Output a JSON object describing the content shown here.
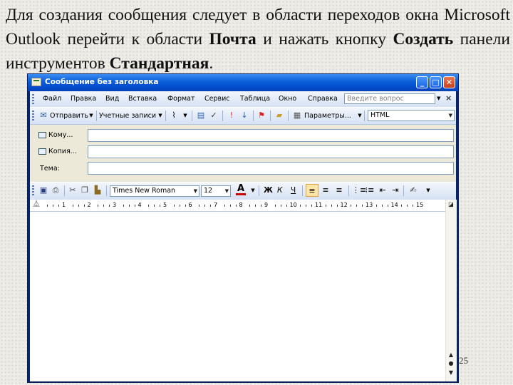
{
  "slide": {
    "paragraph": {
      "part1": "Для создания сообщения следует в области переходов окна Microsoft Outlook перейти к области ",
      "bold1": "Почта",
      "part2": " и нажать кнопку ",
      "bold2": "Создать",
      "part3": " панели инструментов ",
      "bold3": "Стандартная",
      "part4": "."
    },
    "page_number": "25"
  },
  "window": {
    "title": "Сообщение без заголовка",
    "buttons": {
      "minimize": "_",
      "maximize": "□",
      "close": "✕"
    }
  },
  "menubar": {
    "items": [
      "Файл",
      "Правка",
      "Вид",
      "Вставка",
      "Формат",
      "Сервис",
      "Таблица",
      "Окно",
      "Справка"
    ],
    "help_placeholder": "Введите вопрос",
    "close": "×"
  },
  "toolbar": {
    "send_label": "Отправить",
    "accounts_label": "Учетные записи",
    "params_label": "Параметры...",
    "format_value": "HTML"
  },
  "fields": {
    "to_label": "Кому...",
    "cc_label": "Копия...",
    "subject_label": "Тема:",
    "to_value": "",
    "cc_value": "",
    "subject_value": ""
  },
  "formatting": {
    "font": "Times New Roman",
    "size": "12",
    "bold": "Ж",
    "italic": "К",
    "underline": "Ч"
  },
  "ruler": {
    "numbers": [
      "1",
      "2",
      "3",
      "4",
      "5",
      "6",
      "7",
      "8",
      "9",
      "10",
      "11",
      "12",
      "13",
      "14",
      "15"
    ]
  },
  "colors": {
    "titlebar": "#0a5ed7",
    "toolbar": "#d5e1f3",
    "window_bg": "#ece9d8"
  }
}
